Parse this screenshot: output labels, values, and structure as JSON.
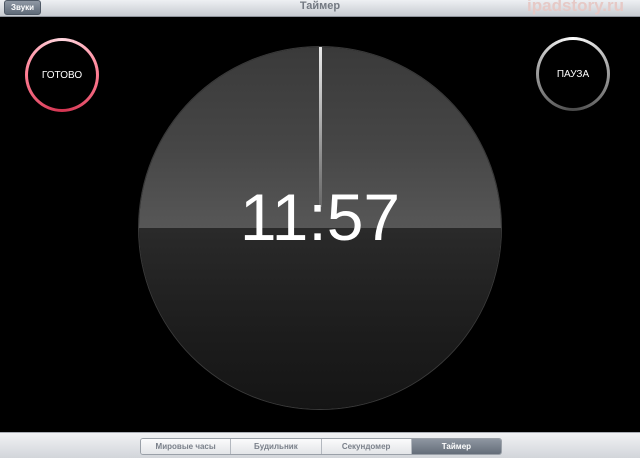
{
  "navbar": {
    "sounds_button": "Звуки",
    "title": "Таймер",
    "watermark": "ipadstory.ru"
  },
  "controls": {
    "done_label": "ГОТОВО",
    "pause_label": "ПАУЗА"
  },
  "timer": {
    "time": "11:57"
  },
  "tabs": [
    {
      "label": "Мировые часы",
      "active": false
    },
    {
      "label": "Будильник",
      "active": false
    },
    {
      "label": "Секундомер",
      "active": false
    },
    {
      "label": "Таймер",
      "active": true
    }
  ],
  "colors": {
    "done_ring": "#ff7c92",
    "pause_ring": "#bdbdbd",
    "background": "#000000"
  }
}
